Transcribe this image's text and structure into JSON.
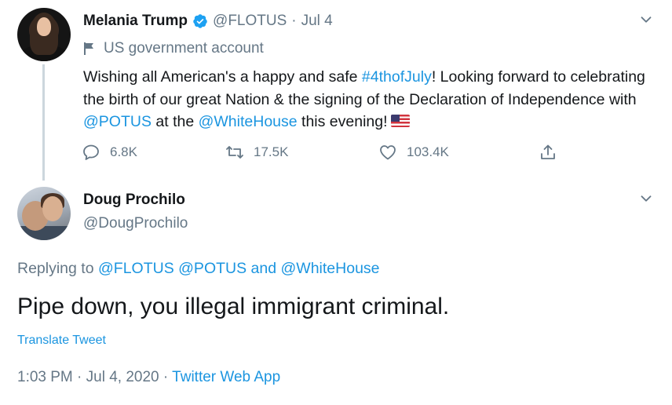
{
  "parent_tweet": {
    "display_name": "Melania Trump",
    "handle": "@FLOTUS",
    "separator": "·",
    "date": "Jul 4",
    "gov_label": "US government account",
    "text": {
      "p1": "Wishing all American's a happy and safe ",
      "hashtag": "#4thofJuly",
      "p2": "! Looking forward to celebrating the birth of our great Nation & the signing of the Declaration of Independence with ",
      "mention1": "@POTUS",
      "p3": " at the ",
      "mention2": "@WhiteHouse",
      "p4": " this evening!"
    },
    "actions": {
      "replies": "6.8K",
      "retweets": "17.5K",
      "likes": "103.4K"
    },
    "icons": {
      "verified": "verified-badge-icon",
      "flag": "flag-icon",
      "reply": "reply-icon",
      "retweet": "retweet-icon",
      "like": "heart-icon",
      "share": "share-icon",
      "menu": "chevron-down-icon"
    }
  },
  "reply_tweet": {
    "display_name": "Doug Prochilo",
    "handle": "@DougProchilo",
    "replying_prefix": "Replying to ",
    "replying_to_1": "@FLOTUS",
    "replying_to_2": "@POTUS",
    "replying_and": " and ",
    "replying_to_3": "@WhiteHouse",
    "text": "Pipe down, you illegal immigrant criminal.",
    "translate_label": "Translate Tweet",
    "time": "1:03 PM",
    "meta_sep": " · ",
    "date": "Jul 4, 2020",
    "source": "Twitter Web App"
  },
  "colors": {
    "link": "#1b95e0",
    "secondary_text": "#657786",
    "primary_text": "#14171a",
    "thread_line": "#ccd6dd"
  }
}
